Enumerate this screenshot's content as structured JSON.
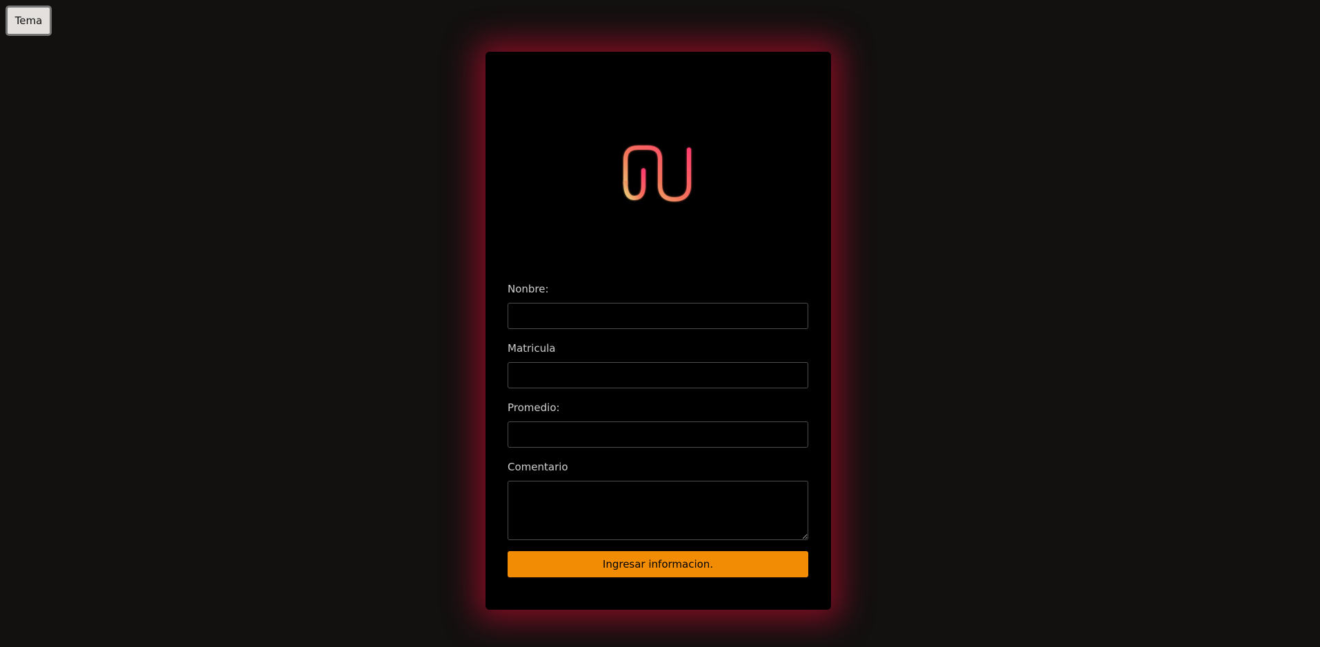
{
  "toolbar": {
    "theme_label": "Tema"
  },
  "card": {
    "glow_color": "#a80e2a",
    "background": "#000000"
  },
  "logo": {
    "icon": "nu-logo-icon",
    "gradient_colors": [
      "#e9d57a",
      "#f4755a",
      "#ff3c6e"
    ]
  },
  "form": {
    "name": {
      "label": "Nonbre:",
      "value": "",
      "placeholder": ""
    },
    "matricula": {
      "label": "Matricula",
      "value": "",
      "placeholder": ""
    },
    "promedio": {
      "label": "Promedio:",
      "value": "",
      "placeholder": ""
    },
    "comentario": {
      "label": "Comentario",
      "value": "",
      "placeholder": ""
    },
    "submit_label": "Ingresar informacion.",
    "submit_color": "#f28c05"
  }
}
